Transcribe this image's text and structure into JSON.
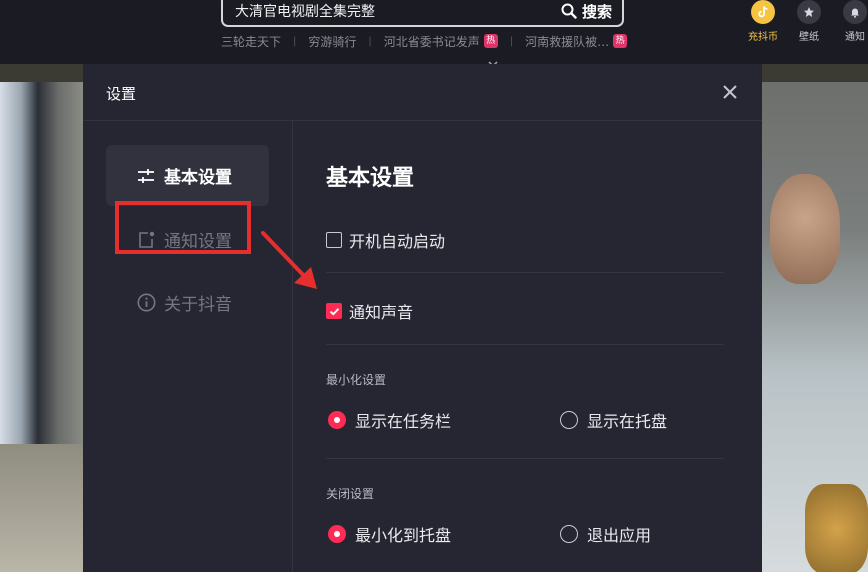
{
  "search": {
    "value": "大清官电视剧全集完整",
    "button_label": "搜索"
  },
  "hot_searches": [
    {
      "text": "三轮走天下",
      "hot": false
    },
    {
      "text": "穷游骑行",
      "hot": false
    },
    {
      "text": "河北省委书记发声",
      "hot": true
    },
    {
      "text": "河南救援队被…",
      "hot": true
    }
  ],
  "hot_badge_text": "热",
  "top_icons": {
    "coin_label": "充抖币",
    "wallpaper_label": "壁纸",
    "notify_label": "通知"
  },
  "dialog": {
    "title": "设置",
    "sidebar": [
      {
        "label": "基本设置",
        "icon": "sliders-icon",
        "active": true
      },
      {
        "label": "通知设置",
        "icon": "notification-icon",
        "active": false
      },
      {
        "label": "关于抖音",
        "icon": "info-icon",
        "active": false
      }
    ],
    "main": {
      "title": "基本设置",
      "auto_start": {
        "label": "开机自动启动",
        "checked": false
      },
      "notify_sound": {
        "label": "通知声音",
        "checked": true
      },
      "minimize_section": {
        "label": "最小化设置",
        "options": [
          {
            "label": "显示在任务栏",
            "selected": true
          },
          {
            "label": "显示在托盘",
            "selected": false
          }
        ]
      },
      "close_section": {
        "label": "关闭设置",
        "options": [
          {
            "label": "最小化到托盘",
            "selected": true
          },
          {
            "label": "退出应用",
            "selected": false
          }
        ]
      }
    }
  },
  "colors": {
    "accent": "#fe2c55",
    "annotation_red": "#e62e2e",
    "dialog_bg": "#252632",
    "topbar_bg": "#1b1b24",
    "coin_gold": "#f6c443"
  }
}
